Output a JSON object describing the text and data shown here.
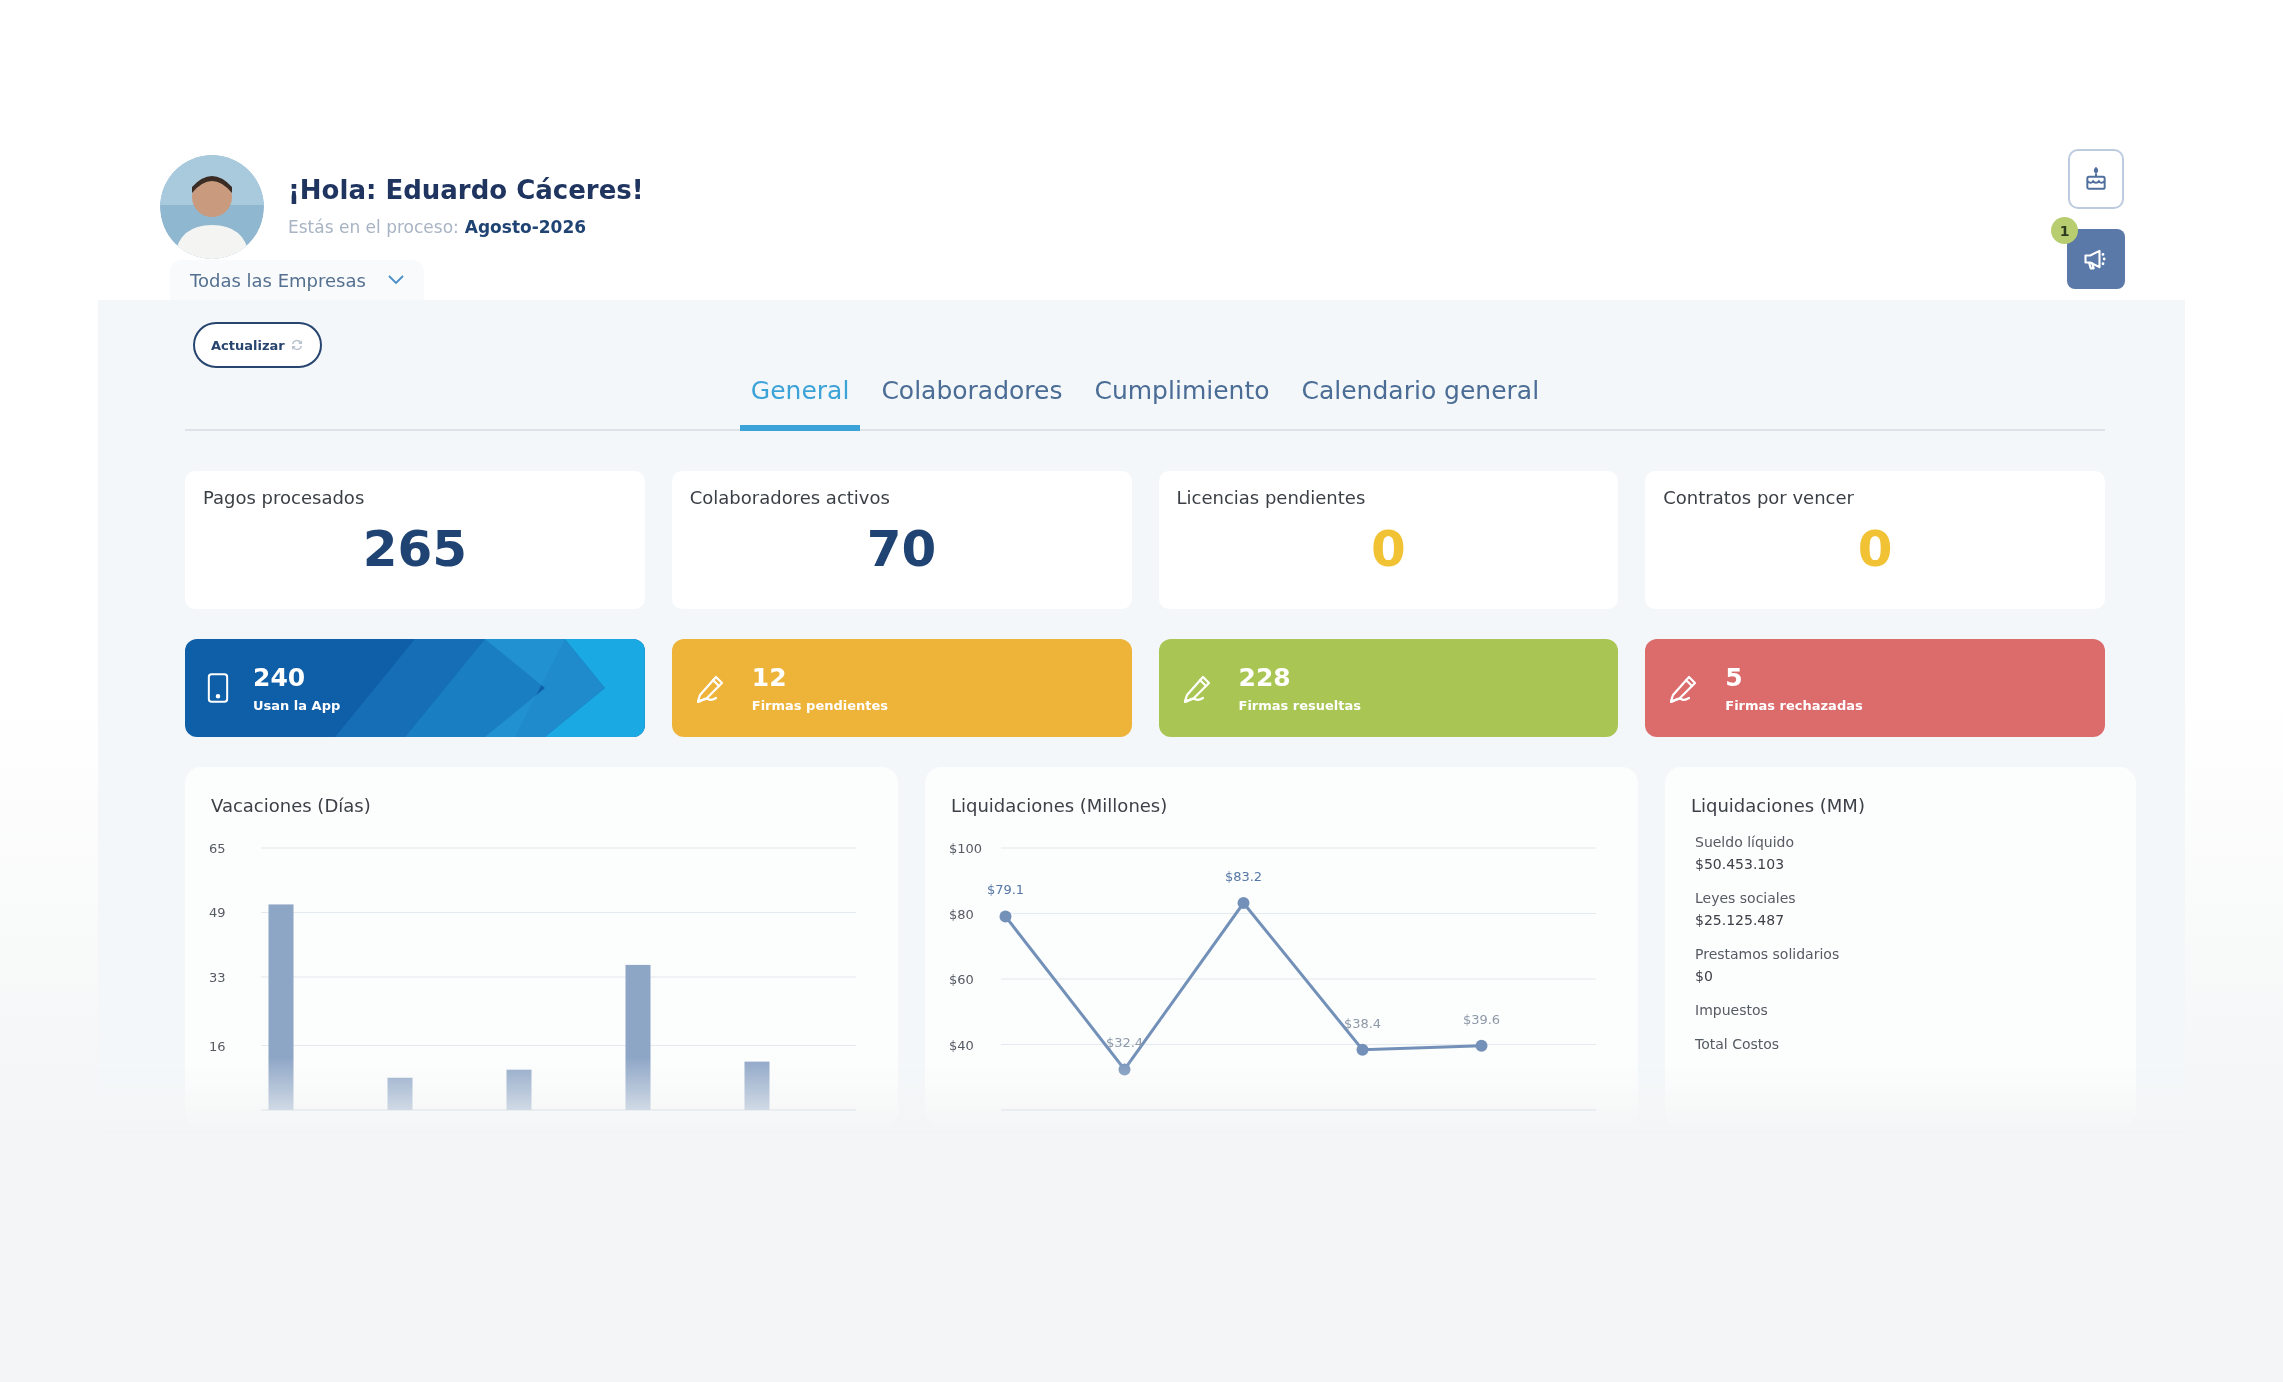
{
  "header": {
    "greeting": "¡Hola: Eduardo Cáceres!",
    "process_label": "Estás en el proceso:",
    "process_value": "Agosto-2026",
    "company_selector": "Todas las Empresas",
    "notification_badge": "1"
  },
  "refresh_button": "Actualizar",
  "tabs": [
    {
      "label": "General",
      "selected": true
    },
    {
      "label": "Colaboradores",
      "selected": false
    },
    {
      "label": "Cumplimiento",
      "selected": false
    },
    {
      "label": "Calendario general",
      "selected": false
    }
  ],
  "stats": [
    {
      "label": "Pagos procesados",
      "value": "265",
      "color": "#1f4373"
    },
    {
      "label": "Colaboradores activos",
      "value": "70",
      "color": "#1f4373"
    },
    {
      "label": "Licencias pendientes",
      "value": "0",
      "color": "#f0c234"
    },
    {
      "label": "Contratos por vencer",
      "value": "0",
      "color": "#f0c234"
    }
  ],
  "summary_cards": [
    {
      "kind": "app",
      "value": "240",
      "label": "Usan la App",
      "color": "#0f5ea8"
    },
    {
      "kind": "signature",
      "value": "12",
      "label": "Firmas pendientes",
      "color": "#eeb43a"
    },
    {
      "kind": "signature",
      "value": "228",
      "label": "Firmas resueltas",
      "color": "#a9c655"
    },
    {
      "kind": "signature",
      "value": "5",
      "label": "Firmas rechazadas",
      "color": "#dc6b6c"
    }
  ],
  "vacaciones": {
    "title": "Vacaciones (Días)",
    "chart_data": {
      "type": "bar",
      "ylim": [
        0,
        65
      ],
      "yticks": [
        16,
        33,
        49,
        65
      ],
      "grid": true,
      "series": [
        {
          "color": "#8ea6c6",
          "values": [
            51,
            8,
            10,
            36,
            12
          ]
        }
      ]
    }
  },
  "liquidaciones": {
    "title": "Liquidaciones (Millones)",
    "chart_data": {
      "type": "line",
      "ylim": [
        20,
        100
      ],
      "grid": true,
      "yticks": [
        {
          "value": 40,
          "label": "$40"
        },
        {
          "value": 60,
          "label": "$60"
        },
        {
          "value": 80,
          "label": "$80"
        },
        {
          "value": 100,
          "label": "$100"
        }
      ],
      "series": [
        {
          "color": "#7391b8",
          "marker": true,
          "values": [
            79.1,
            32.4,
            83.2,
            38.4,
            39.6
          ]
        }
      ],
      "value_labels": [
        "$79.1",
        "$32.4",
        "$83.2",
        "$38.4",
        "$39.6"
      ]
    }
  },
  "liquidaciones_mm": {
    "title": "Liquidaciones (MM)",
    "items": [
      {
        "label": "Sueldo líquido",
        "value": "$50.453.103"
      },
      {
        "label": "Leyes sociales",
        "value": "$25.125.487"
      },
      {
        "label": "Prestamos solidarios",
        "value": "$0"
      },
      {
        "label": "Impuestos"
      },
      {
        "label": "Total Costos"
      }
    ]
  }
}
